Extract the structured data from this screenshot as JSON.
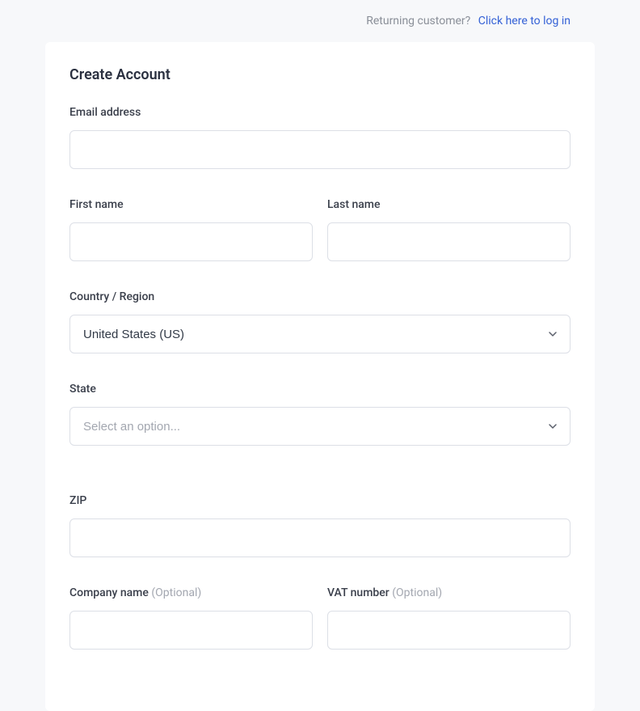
{
  "header": {
    "prompt": "Returning customer?",
    "login_link": "Click here to log in"
  },
  "form": {
    "title": "Create Account",
    "email": {
      "label": "Email address",
      "value": ""
    },
    "first_name": {
      "label": "First name",
      "value": ""
    },
    "last_name": {
      "label": "Last name",
      "value": ""
    },
    "country": {
      "label": "Country / Region",
      "value": "United States (US)"
    },
    "state": {
      "label": "State",
      "placeholder": "Select an option...",
      "value": ""
    },
    "zip": {
      "label": "ZIP",
      "value": ""
    },
    "company": {
      "label": "Company name",
      "optional": "(Optional)",
      "value": ""
    },
    "vat": {
      "label": "VAT number",
      "optional": "(Optional)",
      "value": ""
    }
  }
}
